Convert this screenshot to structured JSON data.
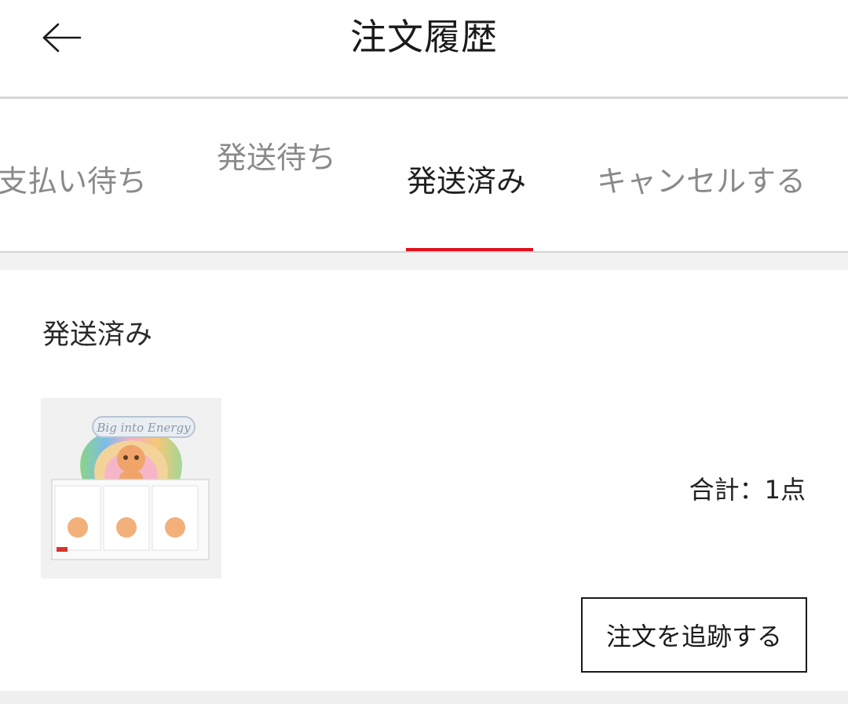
{
  "header": {
    "title": "注文履歴",
    "back_icon": "arrow-left-icon"
  },
  "tabs": [
    {
      "label": "支払い待ち",
      "active": false
    },
    {
      "label": "発送待ち",
      "active": false
    },
    {
      "label": "発送済み",
      "active": true
    },
    {
      "label": "キャンセルする",
      "active": false
    }
  ],
  "order": {
    "status": "発送済み",
    "total": "合計：1点",
    "track_button": "注文を追跡する",
    "product_image": {
      "brand_text": "Big into Energy"
    }
  },
  "colors": {
    "accent": "#e0101b",
    "active_text": "#1f1f1f",
    "inactive_text": "#8a8a8a",
    "divider": "#d6d6d6"
  }
}
